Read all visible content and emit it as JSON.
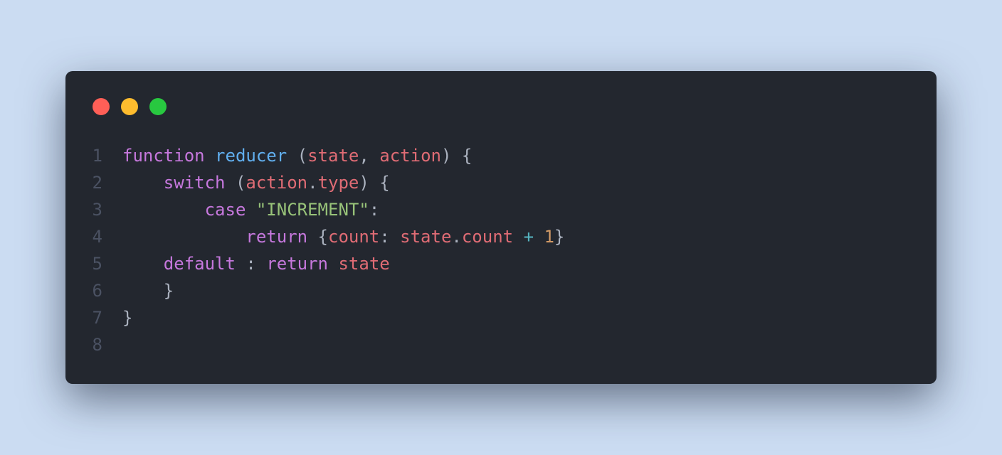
{
  "window": {
    "controls": [
      {
        "name": "close",
        "color": "#ff5f57"
      },
      {
        "name": "minimize",
        "color": "#febc2e"
      },
      {
        "name": "zoom",
        "color": "#28c840"
      }
    ]
  },
  "colors": {
    "keyword": "#c678dd",
    "function": "#61afef",
    "variable": "#e06c75",
    "string": "#98c379",
    "number": "#d19a66",
    "operator": "#56b6c2",
    "punct": "#abb2bf"
  },
  "code": {
    "lines": [
      {
        "number": "1",
        "tokens": [
          {
            "t": "function",
            "c": "keyword"
          },
          {
            "t": " ",
            "c": "punct"
          },
          {
            "t": "reducer",
            "c": "function"
          },
          {
            "t": " (",
            "c": "punct"
          },
          {
            "t": "state",
            "c": "variable"
          },
          {
            "t": ", ",
            "c": "punct"
          },
          {
            "t": "action",
            "c": "variable"
          },
          {
            "t": ") {",
            "c": "punct"
          }
        ]
      },
      {
        "number": "2",
        "tokens": [
          {
            "t": "    ",
            "c": "punct"
          },
          {
            "t": "switch",
            "c": "keyword"
          },
          {
            "t": " (",
            "c": "punct"
          },
          {
            "t": "action",
            "c": "variable"
          },
          {
            "t": ".",
            "c": "punct"
          },
          {
            "t": "type",
            "c": "variable"
          },
          {
            "t": ") {",
            "c": "punct"
          }
        ]
      },
      {
        "number": "3",
        "tokens": [
          {
            "t": "        ",
            "c": "punct"
          },
          {
            "t": "case",
            "c": "keyword"
          },
          {
            "t": " ",
            "c": "punct"
          },
          {
            "t": "\"INCREMENT\"",
            "c": "string"
          },
          {
            "t": ":",
            "c": "punct"
          }
        ]
      },
      {
        "number": "4",
        "tokens": [
          {
            "t": "            ",
            "c": "punct"
          },
          {
            "t": "return",
            "c": "keyword"
          },
          {
            "t": " {",
            "c": "punct"
          },
          {
            "t": "count",
            "c": "variable"
          },
          {
            "t": ": ",
            "c": "punct"
          },
          {
            "t": "state",
            "c": "variable"
          },
          {
            "t": ".",
            "c": "punct"
          },
          {
            "t": "count",
            "c": "variable"
          },
          {
            "t": " ",
            "c": "punct"
          },
          {
            "t": "+",
            "c": "operator"
          },
          {
            "t": " ",
            "c": "punct"
          },
          {
            "t": "1",
            "c": "number"
          },
          {
            "t": "}",
            "c": "punct"
          }
        ]
      },
      {
        "number": "5",
        "tokens": [
          {
            "t": "    ",
            "c": "punct"
          },
          {
            "t": "default",
            "c": "keyword"
          },
          {
            "t": " : ",
            "c": "punct"
          },
          {
            "t": "return",
            "c": "keyword"
          },
          {
            "t": " ",
            "c": "punct"
          },
          {
            "t": "state",
            "c": "variable"
          }
        ]
      },
      {
        "number": "6",
        "tokens": [
          {
            "t": "    }",
            "c": "punct"
          }
        ]
      },
      {
        "number": "7",
        "tokens": [
          {
            "t": "}",
            "c": "punct"
          }
        ]
      },
      {
        "number": "8",
        "tokens": []
      }
    ]
  }
}
